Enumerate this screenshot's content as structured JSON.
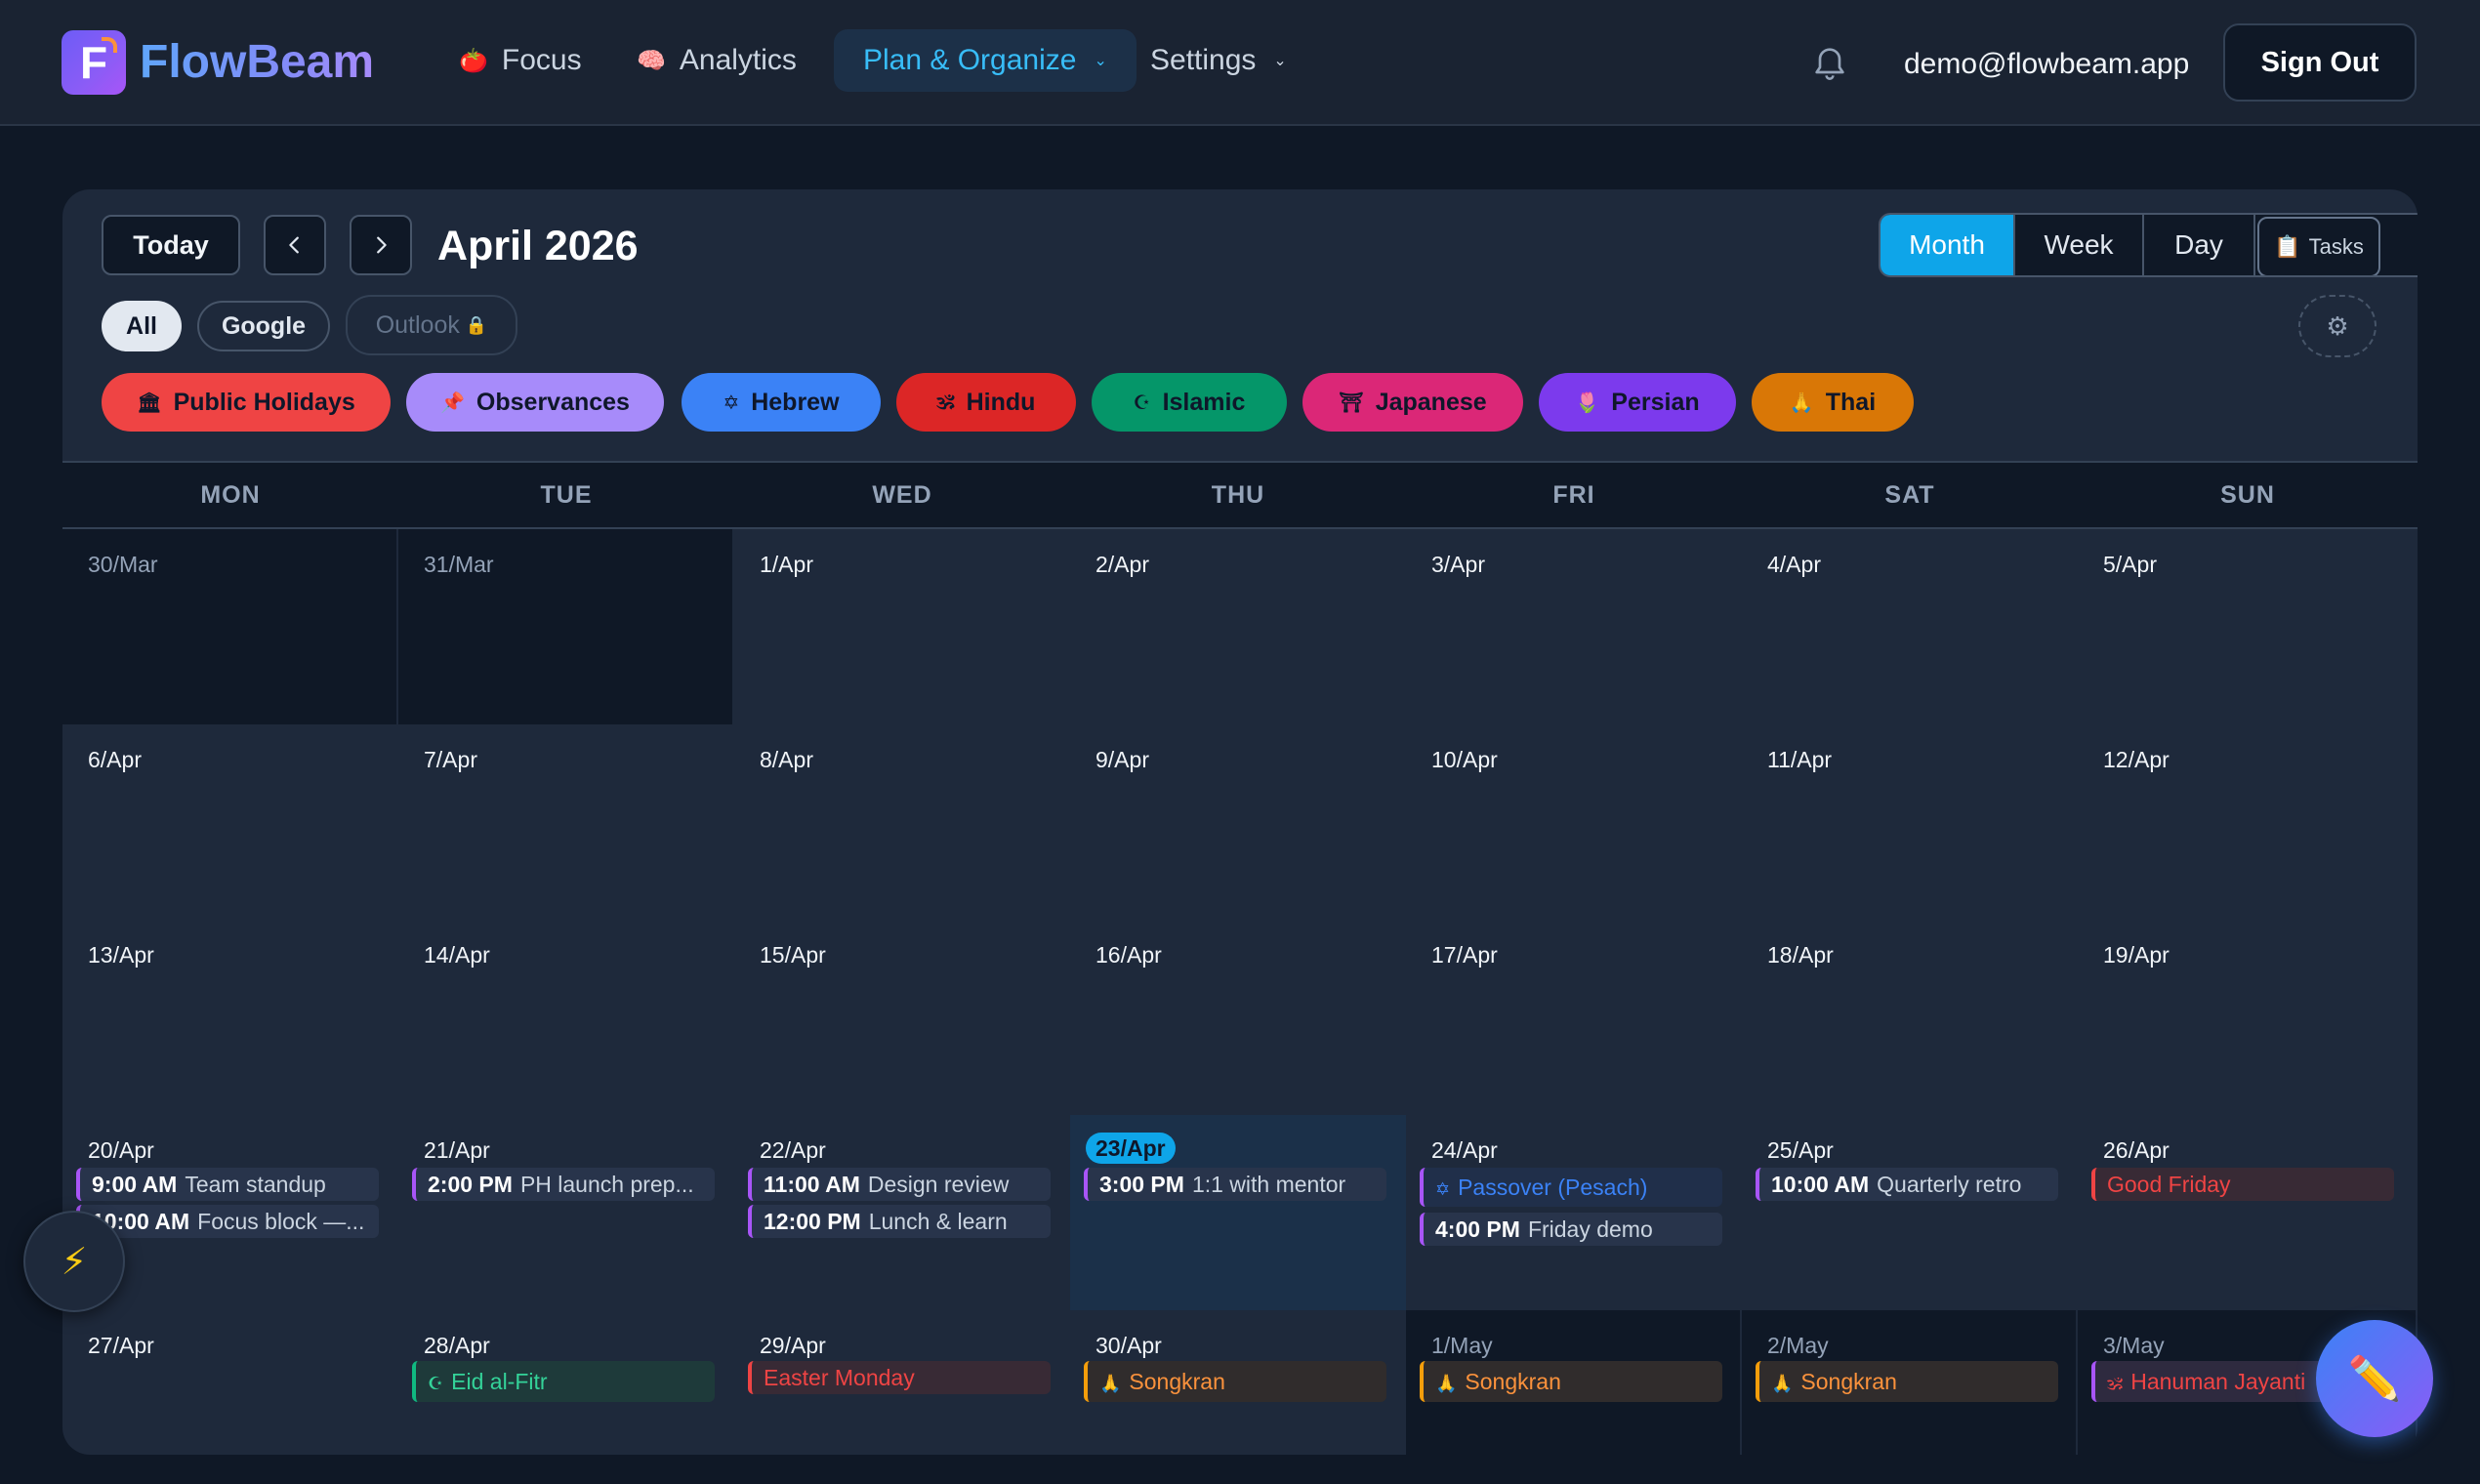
{
  "brand": {
    "logo_letter": "F",
    "name": "FlowBeam"
  },
  "nav": {
    "focus": {
      "emoji": "🍅",
      "label": "Focus"
    },
    "analytics": {
      "emoji": "🧠",
      "label": "Analytics"
    },
    "plan": {
      "label": "Plan & Organize",
      "caret": "⌄"
    },
    "settings": {
      "label": "Settings",
      "caret": "⌄"
    },
    "user_email": "demo@flowbeam.app",
    "sign_out": "Sign Out"
  },
  "toolbar": {
    "today": "Today",
    "prev": "‹",
    "next": "›",
    "month_title": "April 2026",
    "views": [
      "Month",
      "Week",
      "Day"
    ],
    "tasks_label": "Tasks",
    "tasks_emoji": "📋",
    "gear": "⚙"
  },
  "sources": {
    "all": "All",
    "google": "Google",
    "outlook": "Outlook",
    "outlook_lock": "🔒"
  },
  "categories": [
    {
      "emoji": "🏛",
      "label": "Public Holidays",
      "color": "#ef4444"
    },
    {
      "emoji": "📌",
      "label": "Observances",
      "color": "#a78bfa"
    },
    {
      "emoji": "✡",
      "label": "Hebrew",
      "color": "#3b82f6"
    },
    {
      "emoji": "🕉",
      "label": "Hindu",
      "color": "#dc2626"
    },
    {
      "emoji": "☪",
      "label": "Islamic",
      "color": "#059669"
    },
    {
      "emoji": "⛩",
      "label": "Japanese",
      "color": "#db2777"
    },
    {
      "emoji": "🌷",
      "label": "Persian",
      "color": "#7c3aed"
    },
    {
      "emoji": "🙏",
      "label": "Thai",
      "color": "#d97706"
    }
  ],
  "weekdays": [
    "MON",
    "TUE",
    "WED",
    "THU",
    "FRI",
    "SAT",
    "SUN"
  ],
  "weeks": [
    [
      "30/Mar",
      "31/Mar",
      "1/Apr",
      "2/Apr",
      "3/Apr",
      "4/Apr",
      "5/Apr"
    ],
    [
      "6/Apr",
      "7/Apr",
      "8/Apr",
      "9/Apr",
      "10/Apr",
      "11/Apr",
      "12/Apr"
    ],
    [
      "13/Apr",
      "14/Apr",
      "15/Apr",
      "16/Apr",
      "17/Apr",
      "18/Apr",
      "19/Apr"
    ],
    [
      "20/Apr",
      "21/Apr",
      "22/Apr",
      "23/Apr",
      "24/Apr",
      "25/Apr",
      "26/Apr"
    ],
    [
      "27/Apr",
      "28/Apr",
      "29/Apr",
      "30/Apr",
      "1/May",
      "2/May",
      "3/May"
    ]
  ],
  "events": {
    "mon20": [
      {
        "time": "9:00 AM",
        "title": "Team standup"
      },
      {
        "time": "10:00 AM",
        "title": "Focus block —..."
      }
    ],
    "tue21": [
      {
        "time": "2:00 PM",
        "title": "PH launch prep..."
      }
    ],
    "wed22": [
      {
        "time": "11:00 AM",
        "title": "Design review"
      },
      {
        "time": "12:00 PM",
        "title": "Lunch & learn"
      }
    ],
    "thu23": [
      {
        "time": "3:00 PM",
        "title": "1:1 with mentor"
      }
    ],
    "fri24": [
      {
        "emoji": "✡",
        "title": "Passover (Pesach)"
      },
      {
        "time": "4:00 PM",
        "title": "Friday demo"
      }
    ],
    "sat25": [
      {
        "time": "10:00 AM",
        "title": "Quarterly retro"
      }
    ],
    "sun26": [
      {
        "title": "Good Friday"
      }
    ],
    "tue28": [
      {
        "emoji": "☪",
        "title": "Eid al-Fitr"
      }
    ],
    "wed29": [
      {
        "title": "Easter Monday"
      }
    ],
    "thu30": [
      {
        "emoji": "🙏",
        "title": "Songkran"
      }
    ],
    "fri1": [
      {
        "emoji": "🙏",
        "title": "Songkran"
      }
    ],
    "sat2": [
      {
        "emoji": "🙏",
        "title": "Songkran"
      }
    ],
    "sun3": [
      {
        "emoji": "🕉",
        "title": "Hanuman Jayanti"
      }
    ]
  },
  "fab": {
    "bolt": "⚡",
    "edit": "✏️"
  },
  "colors": {
    "accent": "#0ea5e9",
    "background": "#0f1826",
    "card": "#1e293b"
  }
}
